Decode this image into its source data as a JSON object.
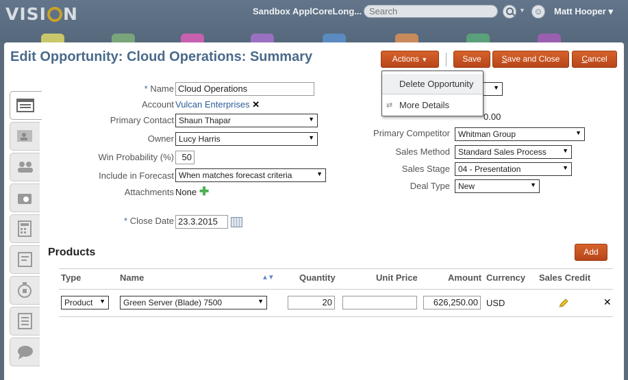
{
  "header": {
    "logo": "VISION",
    "sandbox": "Sandbox ApplCoreLong...",
    "search_placeholder": "Search",
    "user": "Matt Hooper"
  },
  "page": {
    "title": "Edit Opportunity: Cloud Operations: Summary"
  },
  "toolbar": {
    "actions": "Actions",
    "save": "Save",
    "save_close_u": "S",
    "save_close_rest": "ave and Close",
    "cancel_u": "C",
    "cancel_rest": "ancel"
  },
  "actions_menu": {
    "delete": "Delete Opportunity",
    "more": "More Details"
  },
  "form": {
    "name_label": "Name",
    "name_value": "Cloud Operations",
    "account_label": "Account",
    "account_value": "Vulcan Enterprises",
    "primary_contact_label": "Primary Contact",
    "primary_contact_value": "Shaun Thapar",
    "owner_label": "Owner",
    "owner_value": "Lucy Harris",
    "win_prob_label": "Win Probability (%)",
    "win_prob_value": "50",
    "forecast_label": "Include in Forecast",
    "forecast_value": "When matches forecast criteria",
    "attachments_label": "Attachments",
    "attachments_value": "None",
    "close_date_label": "Close Date",
    "close_date_value": "23.3.2015",
    "hidden_amount": "0.00",
    "competitor_label": "Primary Competitor",
    "competitor_value": "Whitman Group",
    "sales_method_label": "Sales Method",
    "sales_method_value": "Standard Sales Process",
    "sales_stage_label": "Sales Stage",
    "sales_stage_value": "04 - Presentation",
    "deal_type_label": "Deal Type",
    "deal_type_value": "New"
  },
  "products": {
    "title": "Products",
    "add": "Add",
    "columns": {
      "type": "Type",
      "name": "Name",
      "quantity": "Quantity",
      "unit_price": "Unit Price",
      "amount": "Amount",
      "currency": "Currency",
      "sales_credit": "Sales Credit"
    },
    "rows": [
      {
        "type": "Product",
        "name": "Green Server (Blade) 7500",
        "quantity": "20",
        "unit_price": "",
        "amount": "626,250.00",
        "currency": "USD"
      }
    ]
  },
  "colors": {
    "accent": "#c8551f",
    "title": "#4a6a8a",
    "header": "#5b6b7c"
  }
}
